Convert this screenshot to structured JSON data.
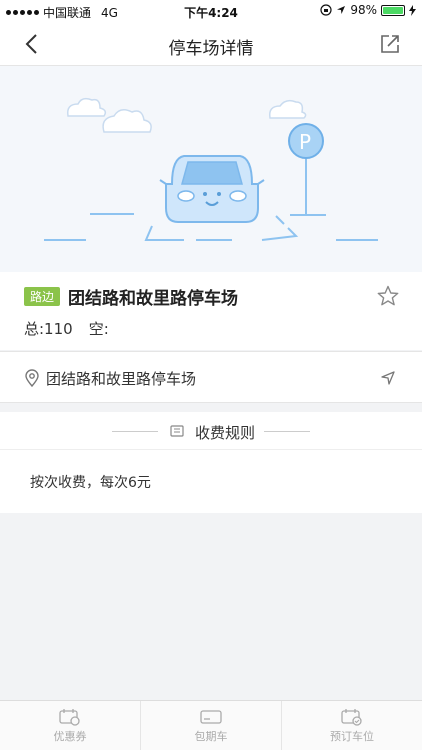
{
  "status_bar": {
    "carrier": "中国联通",
    "network": "4G",
    "time": "下午4:24",
    "battery_percent": "98%",
    "battery_level": 0.98
  },
  "nav": {
    "title": "停车场详情",
    "back_icon": "chevron-left-icon",
    "share_icon": "share-icon"
  },
  "lot": {
    "badge": "路边",
    "name": "团结路和故里路停车场",
    "total_label": "总:110",
    "empty_label": "空:",
    "favorite_icon": "star-icon"
  },
  "address": {
    "text": "团结路和故里路停车场",
    "pin_icon": "location-pin-icon",
    "navigate_icon": "navigation-arrow-icon"
  },
  "fee": {
    "title": "收费规则",
    "rule": "按次收费，每次6元"
  },
  "tabs": [
    {
      "label": "优惠券",
      "icon": "coupon-icon"
    },
    {
      "label": "包期车",
      "icon": "card-icon"
    },
    {
      "label": "预订车位",
      "icon": "calendar-check-icon"
    }
  ],
  "colors": {
    "badge": "#8bc34a",
    "illustration_blue": "#8ec3f0",
    "battery": "#4cd964"
  }
}
